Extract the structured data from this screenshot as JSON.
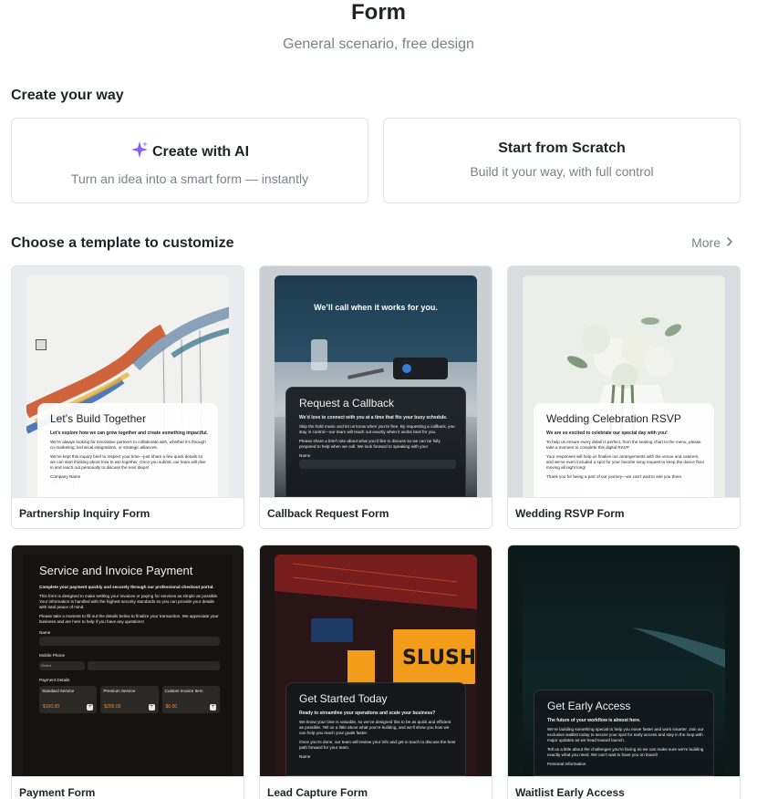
{
  "header": {
    "title": "Form",
    "subtitle": "General scenario, free design"
  },
  "create_section": {
    "title": "Create your way",
    "ai_card": {
      "icon": "sparkle-icon",
      "title": "Create with AI",
      "description": "Turn an idea into a smart form — instantly"
    },
    "scratch_card": {
      "title": "Start from Scratch",
      "description": "Build it your way, with full control"
    }
  },
  "template_section": {
    "title": "Choose a template to customize",
    "more_label": "More",
    "templates": [
      {
        "label": "Partnership Inquiry Form",
        "heading": "Let’s Build Together",
        "lead": "Let’s explore how we can grow together and create something impactful.",
        "body1": "We’re always looking for innovative partners to collaborate with, whether it’s through co-marketing, technical integrations, or strategic alliances.",
        "body2": "We’ve kept this inquiry brief to respect your time—just share a few quick details so we can start thinking about how to win together. Once you submit, our team will dive in and reach out personally to discuss the next steps!",
        "field": "Company Name"
      },
      {
        "label": "Callback Request Form",
        "banner": "We’ll call when it works for you.",
        "heading": "Request a Callback",
        "lead": "We’d love to connect with you at a time that fits your busy schedule.",
        "body1": "Skip the hold music and let us know when you’re free. By requesting a callback, you stay in control—our team will reach out exactly when it works best for you.",
        "body2": "Please share a brief note about what you’d like to discuss so we can be fully prepared to help when we call. We look forward to speaking with you!",
        "field": "Name"
      },
      {
        "label": "Wedding RSVP Form",
        "heading": "Wedding Celebration RSVP",
        "lead": "We are so excited to celebrate our special day with you!",
        "body1": "To help us ensure every detail is perfect, from the seating chart to the menu, please take a moment to complete this digital RSVP.",
        "body2": "Your responses will help us finalize our arrangements with the venue and caterers, and we’ve even included a spot for your favorite song request to keep the dance floor moving all night long!",
        "body3": "Thank you for being a part of our journey—we can’t wait to see you there."
      },
      {
        "label": "Payment Form",
        "heading": "Service and Invoice Payment",
        "lead": "Complete your payment quickly and securely through our professional checkout portal.",
        "body1": "This form is designed to make settling your invoices or paying for services as simple as possible. Your information is handled with the highest security standards so you can provide your details with total peace of mind.",
        "body2": "Please take a moment to fill out the details below to finalize your transaction. We appreciate your business and are here to help if you have any questions!",
        "field_name": "Name",
        "field_phone": "Mobile Phone",
        "select_placeholder": "Select",
        "payment_details": "Payment Details",
        "items": [
          {
            "name": "Standard Service",
            "amount": "$100.00"
          },
          {
            "name": "Premium Service",
            "amount": "$200.00"
          },
          {
            "name": "Custom Invoice Item",
            "amount": "$0.00"
          }
        ]
      },
      {
        "label": "Lead Capture Form",
        "heading": "Get Started Today",
        "lead": "Ready to streamline your operations and scale your business?",
        "body1": "We know your time is valuable, so we’ve designed this to be as quick and efficient as possible. Tell us a little about what you’re building, and we’ll show you how we can help you reach your goals faster.",
        "body2": "Once you’re done, our team will review your info and get in touch to discuss the best path forward for your team.",
        "sign": "SLUSH",
        "field": "Name"
      },
      {
        "label": "Waitlist Early Access",
        "heading": "Get Early Access",
        "lead": "The future of your workflow is almost here.",
        "body1": "We’re building something special to help you move faster and work smarter. Join our exclusive waitlist today to secure your spot for early access and stay in the loop with major updates as we head toward launch.",
        "body2": "Tell us a little about the challenges you’re facing so we can make sure we’re building exactly what you need. We can’t wait to have you on board!",
        "field": "Personal Information"
      }
    ]
  },
  "colors": {
    "accent_sparkle": "#8b5cf6",
    "border": "#dfe2e6",
    "muted_text": "#7a8189"
  }
}
